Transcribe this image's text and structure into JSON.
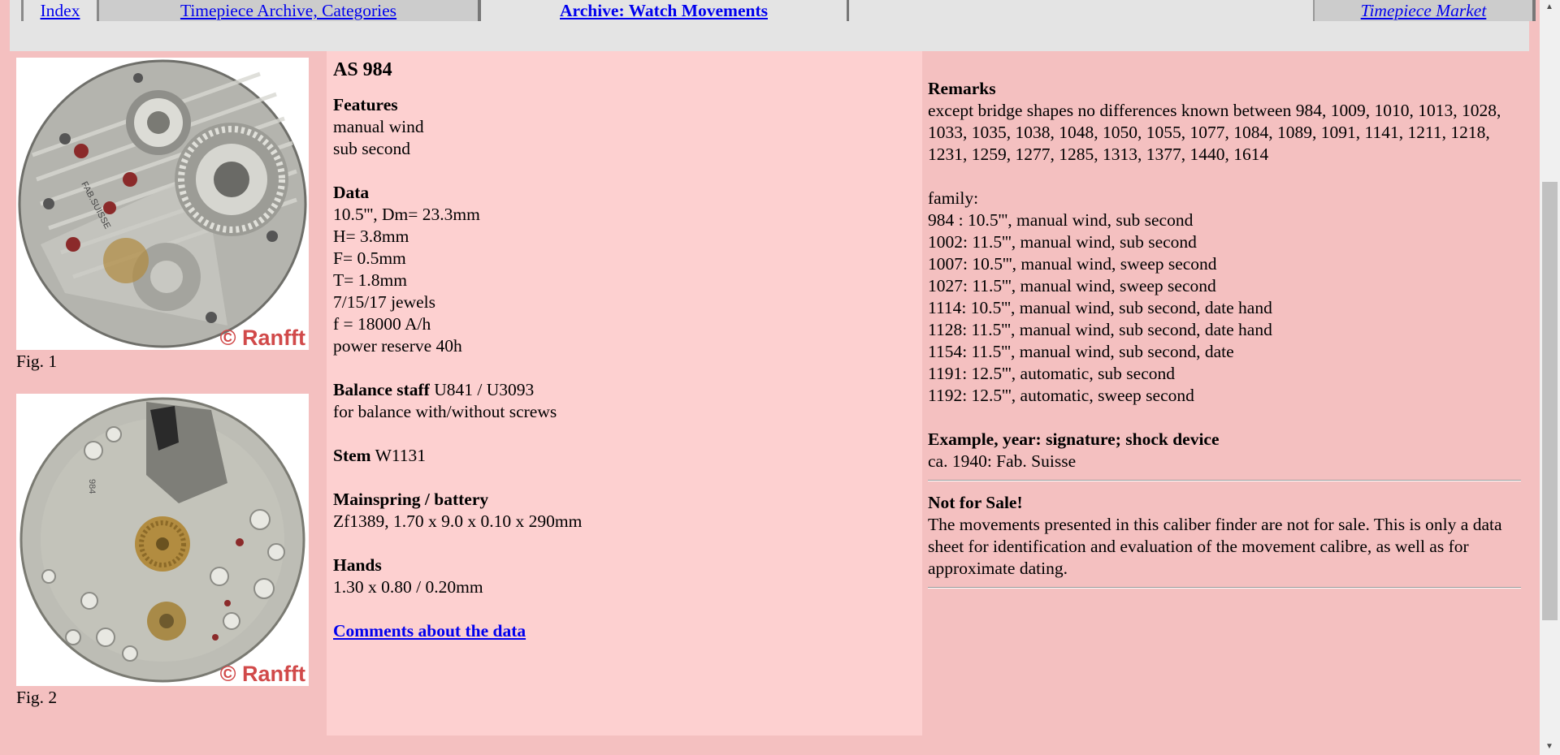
{
  "nav": {
    "index": "Index",
    "archive": "Timepiece Archive, Categories",
    "current": "Archive: Watch Movements",
    "market": "Timepiece Market"
  },
  "figures": [
    {
      "caption": "Fig. 1",
      "watermark": "© Ranfft",
      "dial_text": "FAB.SUISSE"
    },
    {
      "caption": "Fig. 2",
      "watermark": "© Ranfft",
      "dial_text": "984"
    }
  ],
  "data": {
    "title": "AS 984",
    "features_head": "Features",
    "features": [
      "manual wind",
      "sub second"
    ],
    "data_head": "Data",
    "data_lines": [
      "10.5''', Dm= 23.3mm",
      "H= 3.8mm",
      "F= 0.5mm",
      "T= 1.8mm",
      "7/15/17 jewels",
      "f = 18000 A/h",
      "power reserve 40h"
    ],
    "balance_head": "Balance staff",
    "balance_value": " U841 / U3093",
    "balance_note": "for balance with/without screws",
    "stem_head": "Stem",
    "stem_value": " W1131",
    "mainspring_head": "Mainspring / battery",
    "mainspring_value": "Zf1389, 1.70 x 9.0 x 0.10 x 290mm",
    "hands_head": "Hands",
    "hands_value": "1.30 x 0.80 / 0.20mm",
    "comments_link": "Comments about the data"
  },
  "remarks": {
    "head": "Remarks",
    "text": "except bridge shapes no differences known between 984, 1009, 1010, 1013, 1028, 1033, 1035, 1038, 1048, 1050, 1055, 1077, 1084, 1089, 1091, 1141, 1211, 1218, 1231, 1259, 1277, 1285, 1313, 1377, 1440, 1614",
    "family_label": "family:",
    "family": [
      "984 : 10.5''', manual wind, sub second",
      "1002: 11.5''', manual wind, sub second",
      "1007: 10.5''', manual wind, sweep second",
      "1027: 11.5''', manual wind, sweep second",
      "1114: 10.5''', manual wind, sub second, date hand",
      "1128: 11.5''', manual wind, sub second, date hand",
      "1154: 11.5''', manual wind, sub second, date",
      "1191: 12.5''', automatic, sub second",
      "1192: 12.5''', automatic, sweep second"
    ],
    "example_head": "Example, year: signature; shock device",
    "example_value": "ca. 1940: Fab. Suisse",
    "notforsale_head": "Not for Sale!",
    "notforsale_text": "The movements presented in this caliber finder are not for sale. This is only a data sheet for identification and evaluation of the movement calibre, as well as for approximate dating."
  },
  "colors": {
    "page_bg": "#f4c0c0",
    "data_bg": "#fdd0d0",
    "nav_bg": "#e4e4e4",
    "link": "#0000ee",
    "watermark": "#d14a4a"
  },
  "icons": {
    "scroll_up": "triangle-up",
    "scroll_down": "triangle-down"
  }
}
